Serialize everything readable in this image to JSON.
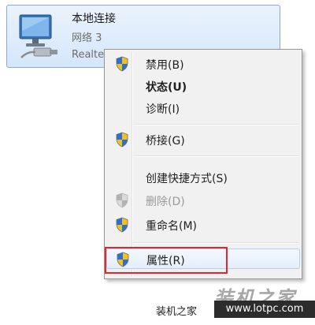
{
  "adapter": {
    "name": "本地连接",
    "network": "网络  3",
    "device": "Realtek PCIe GBE Family Controller"
  },
  "menu": {
    "items": [
      {
        "label": "禁用(B)",
        "shield": true
      },
      {
        "label": "状态(U)",
        "bold": true
      },
      {
        "label": "诊断(I)"
      },
      {
        "label": "桥接(G)",
        "shield": true
      },
      {
        "label": "创建快捷方式(S)"
      },
      {
        "label": "删除(D)",
        "shield": true,
        "disabled": true
      },
      {
        "label": "重命名(M)",
        "shield": true
      },
      {
        "label": "属性(R)",
        "shield": true,
        "highlighted": true
      }
    ]
  },
  "annotation": {
    "color": "#e0272b"
  },
  "watermark": {
    "logo": "装机之家",
    "text": "装机之家",
    "url": "www.lotpc.com"
  }
}
